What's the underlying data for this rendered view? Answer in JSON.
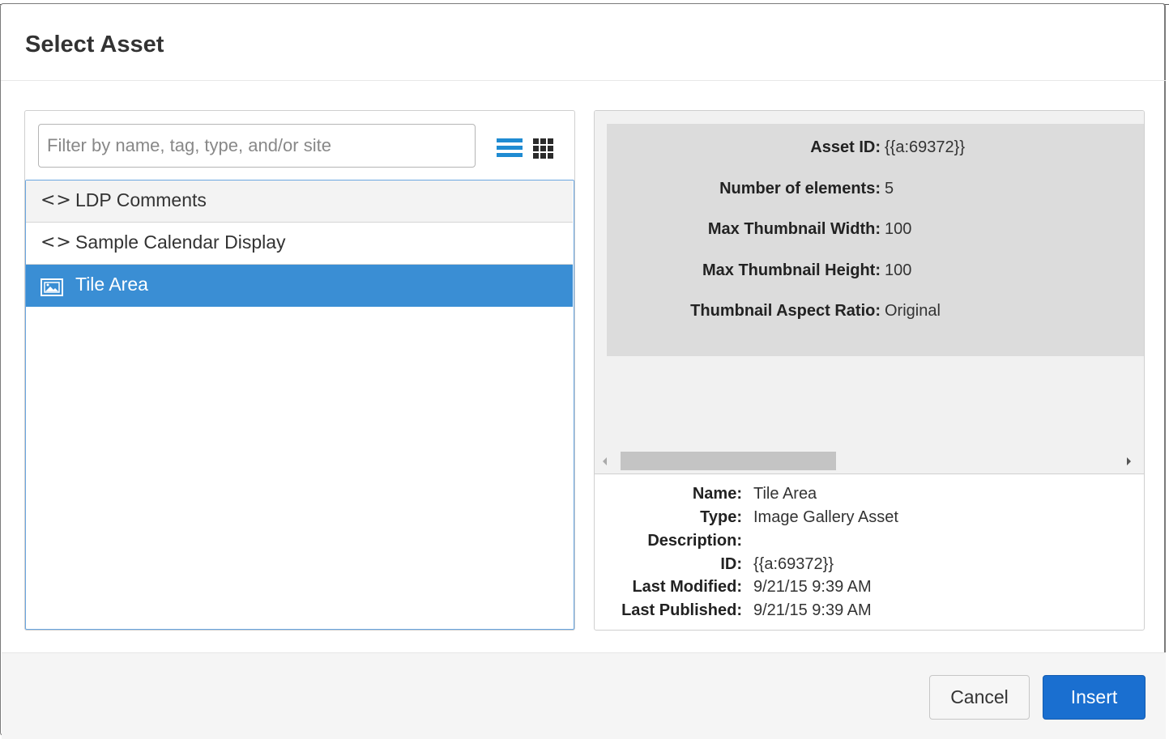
{
  "dialog": {
    "title": "Select Asset"
  },
  "filter": {
    "placeholder": "Filter by name, tag, type, and/or site",
    "value": ""
  },
  "view_toggle": {
    "list_icon": "list-view-icon",
    "grid_icon": "grid-view-icon",
    "active": "list"
  },
  "assets": [
    {
      "label": "LDP Comments",
      "icon": "code-icon",
      "state": "hover"
    },
    {
      "label": "Sample Calendar Display",
      "icon": "code-icon",
      "state": "normal"
    },
    {
      "label": "Tile Area",
      "icon": "image-gallery-icon",
      "state": "selected"
    }
  ],
  "preview": {
    "properties": [
      {
        "key": "Asset ID:",
        "value": "{{a:69372}}"
      },
      {
        "key": "Number of elements:",
        "value": "5"
      },
      {
        "key": "Max Thumbnail Width:",
        "value": "100"
      },
      {
        "key": "Max Thumbnail Height:",
        "value": "100"
      },
      {
        "key": "Thumbnail Aspect Ratio:",
        "value": "Original"
      }
    ]
  },
  "details": [
    {
      "key": "Name:",
      "value": "Tile Area"
    },
    {
      "key": "Type:",
      "value": "Image Gallery Asset"
    },
    {
      "key": "Description:",
      "value": ""
    },
    {
      "key": "ID:",
      "value": "{{a:69372}}"
    },
    {
      "key": "Last Modified:",
      "value": "9/21/15 9:39 AM"
    },
    {
      "key": "Last Published:",
      "value": "9/21/15 9:39 AM"
    }
  ],
  "footer": {
    "cancel_label": "Cancel",
    "insert_label": "Insert"
  },
  "colors": {
    "accent": "#3a8ed4",
    "primary_button": "#1a6fd0",
    "view_toggle_active": "#1f8bd2"
  }
}
